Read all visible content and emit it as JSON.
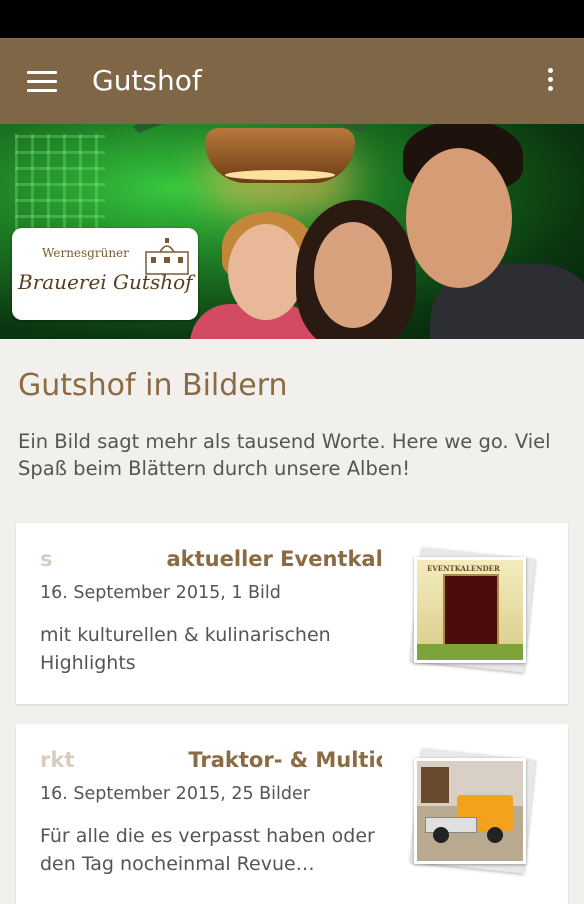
{
  "app_bar": {
    "title": "Gutshof"
  },
  "hero": {
    "logo_line1": "Wernesgrüner",
    "logo_line2": "Brauerei Gutshof"
  },
  "page": {
    "title": "Gutshof in Bildern",
    "intro": "Ein Bild sagt mehr als tausend Worte. Here we go. Viel Spaß beim Blättern durch unsere Alben!"
  },
  "albums": [
    {
      "ticker_ghost": "s",
      "title": "aktueller Eventkale",
      "meta": "16. September 2015, 1 Bild",
      "description": "mit kulturellen & kulinarischen Highlights",
      "thumb_text": "EVENTKALENDER"
    },
    {
      "ticker_ghost": "rkt",
      "title": "Traktor- & Multica",
      "meta": "16. September 2015, 25 Bilder",
      "description": "Für alle die es verpasst haben oder den Tag nocheinmal Revue…"
    }
  ],
  "colors": {
    "app_bar": "#7e6647",
    "accent_text": "#8a6b43",
    "background": "#f2f0ed"
  }
}
